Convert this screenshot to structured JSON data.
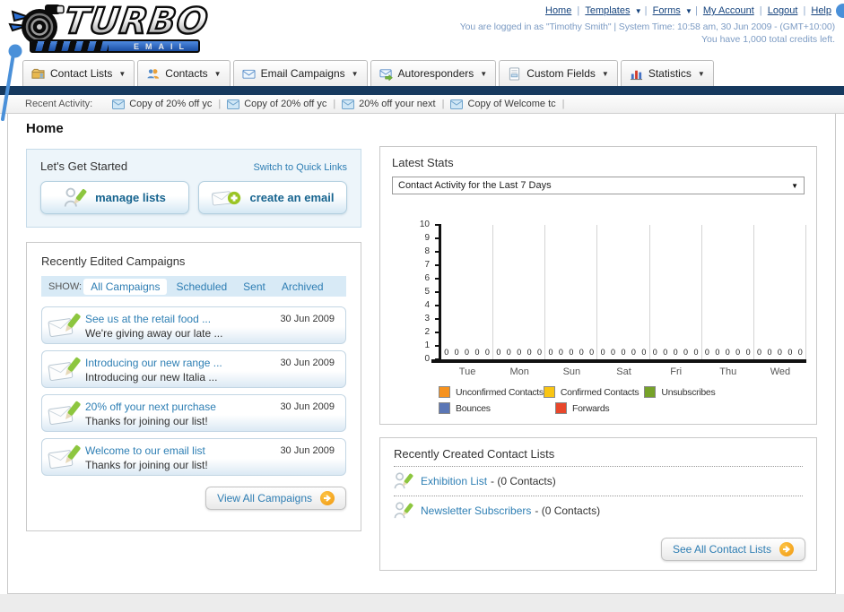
{
  "header": {
    "logo": {
      "title": "TURBO",
      "subtitle": "EMAIL"
    },
    "nav_links": [
      {
        "label": "Home",
        "dropdown": false
      },
      {
        "label": "Templates",
        "dropdown": true
      },
      {
        "label": "Forms",
        "dropdown": true
      },
      {
        "label": "My Account",
        "dropdown": false
      },
      {
        "label": "Logout",
        "dropdown": false
      },
      {
        "label": "Help",
        "dropdown": false
      }
    ],
    "login_line": "You are logged in as \"Timothy Smith\" | System Time: 10:58 am, 30 Jun 2009 - (GMT+10:00)",
    "credits_line": "You have 1,000 total credits left."
  },
  "nav_tabs": [
    {
      "label": "Contact Lists",
      "icon": "contact-lists-icon"
    },
    {
      "label": "Contacts",
      "icon": "contacts-icon"
    },
    {
      "label": "Email Campaigns",
      "icon": "email-campaigns-icon"
    },
    {
      "label": "Autoresponders",
      "icon": "autoresponders-icon"
    },
    {
      "label": "Custom Fields",
      "icon": "custom-fields-icon"
    },
    {
      "label": "Statistics",
      "icon": "statistics-icon"
    }
  ],
  "recent_activity": {
    "label": "Recent Activity:",
    "items": [
      "Copy of 20% off yc",
      "Copy of 20% off yc",
      "20% off your next",
      "Copy of Welcome tc"
    ]
  },
  "page_title": "Home",
  "get_started": {
    "title": "Let's Get Started",
    "switch_link": "Switch to Quick Links",
    "manage_button": "manage lists",
    "create_button": "create an email"
  },
  "campaigns": {
    "title": "Recently Edited Campaigns",
    "show_label": "SHOW:",
    "filters": [
      "All Campaigns",
      "Scheduled",
      "Sent",
      "Archived"
    ],
    "active_filter": "All Campaigns",
    "view_all_button": "View All Campaigns",
    "items": [
      {
        "title": "See us at the retail food ...",
        "subtitle": "We're giving away our late ...",
        "date": "30 Jun 2009"
      },
      {
        "title": "Introducing our new range ...",
        "subtitle": "Introducing our new Italia ...",
        "date": "30 Jun 2009"
      },
      {
        "title": "20% off your next purchase",
        "subtitle": "Thanks for joining our list!",
        "date": "30 Jun 2009"
      },
      {
        "title": "Welcome to our email list",
        "subtitle": "Thanks for joining our list!",
        "date": "30 Jun 2009"
      }
    ]
  },
  "stats": {
    "title": "Latest Stats",
    "dropdown_value": "Contact Activity for the Last 7 Days"
  },
  "chart_data": {
    "type": "bar",
    "title": "Contact Activity for the Last 7 Days",
    "categories": [
      "Tue",
      "Mon",
      "Sun",
      "Sat",
      "Fri",
      "Thu",
      "Wed"
    ],
    "series": [
      {
        "name": "Unconfirmed Contacts",
        "color": "#f6921e",
        "values": [
          0,
          0,
          0,
          0,
          0,
          0,
          0
        ]
      },
      {
        "name": "Confirmed Contacts",
        "color": "#f9c513",
        "values": [
          0,
          0,
          0,
          0,
          0,
          0,
          0
        ]
      },
      {
        "name": "Unsubscribes",
        "color": "#76a229",
        "values": [
          0,
          0,
          0,
          0,
          0,
          0,
          0
        ]
      },
      {
        "name": "Bounces",
        "color": "#5b76b5",
        "values": [
          0,
          0,
          0,
          0,
          0,
          0,
          0
        ]
      },
      {
        "name": "Forwards",
        "color": "#e8472b",
        "values": [
          0,
          0,
          0,
          0,
          0,
          0,
          0
        ]
      }
    ],
    "ylim": [
      0,
      10
    ],
    "yticks": [
      0,
      1,
      2,
      3,
      4,
      5,
      6,
      7,
      8,
      9,
      10
    ],
    "grid": "vertical",
    "legend_position": "bottom"
  },
  "contact_lists": {
    "title": "Recently Created Contact Lists",
    "see_all_button": "See All Contact Lists",
    "items": [
      {
        "name": "Exhibition List",
        "suffix": "- (0 Contacts)"
      },
      {
        "name": "Newsletter Subscribers",
        "suffix": "- (0 Contacts)"
      }
    ]
  }
}
